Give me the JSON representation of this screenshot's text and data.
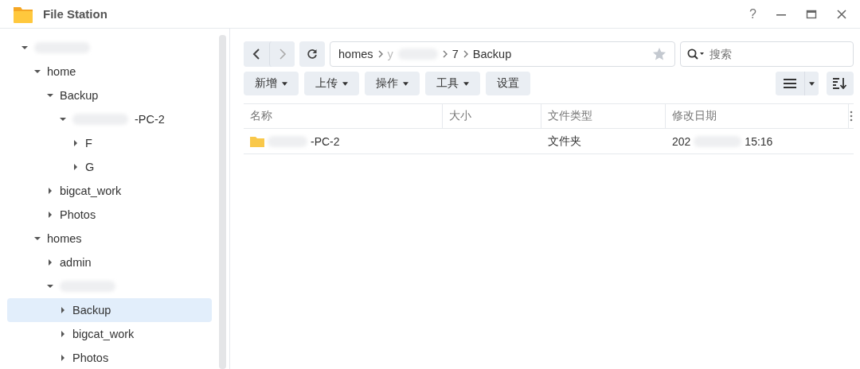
{
  "window": {
    "title": "File Station",
    "controls": [
      "?"
    ]
  },
  "tree": [
    {
      "redacted": true,
      "expanded": true,
      "selected": false,
      "children": [
        {
          "label": "home",
          "expanded": true,
          "selected": false,
          "children": [
            {
              "label": "Backup",
              "expanded": true,
              "selected": false,
              "children": [
                {
                  "label": "-PC-2",
                  "redacted": true,
                  "expanded": true,
                  "selected": false,
                  "children": [
                    {
                      "label": "F",
                      "expanded": false,
                      "selected": false
                    },
                    {
                      "label": "G",
                      "expanded": false,
                      "selected": false
                    }
                  ]
                }
              ]
            },
            {
              "label": "bigcat_work",
              "expanded": false,
              "selected": false
            },
            {
              "label": "Photos",
              "expanded": false,
              "selected": false
            }
          ]
        },
        {
          "label": "homes",
          "expanded": true,
          "selected": false,
          "children": [
            {
              "label": "admin",
              "expanded": false,
              "selected": false
            },
            {
              "redacted": true,
              "expanded": true,
              "selected": false,
              "children": [
                {
                  "label": "Backup",
                  "expanded": false,
                  "selected": true
                },
                {
                  "label": "bigcat_work",
                  "expanded": false,
                  "selected": false
                },
                {
                  "label": "Photos",
                  "expanded": false,
                  "selected": false
                }
              ]
            }
          ]
        }
      ]
    }
  ],
  "path": [
    {
      "label": "homes"
    },
    {
      "label": "y",
      "redacted": true
    },
    {
      "label": "7"
    },
    {
      "label": "Backup"
    }
  ],
  "search": {
    "placeholder": "搜索"
  },
  "actions": [
    {
      "label": "新增",
      "menu": true
    },
    {
      "label": "上传",
      "menu": true
    },
    {
      "label": "操作",
      "menu": true
    },
    {
      "label": "工具",
      "menu": true
    },
    {
      "label": "设置",
      "menu": false
    }
  ],
  "table": {
    "columns": [
      "名称",
      "大小",
      "文件类型",
      "修改日期"
    ],
    "rows": [
      {
        "name": "-PC-2",
        "type": "文件夹",
        "modified": "202",
        "modified_end": "15:16"
      }
    ]
  }
}
